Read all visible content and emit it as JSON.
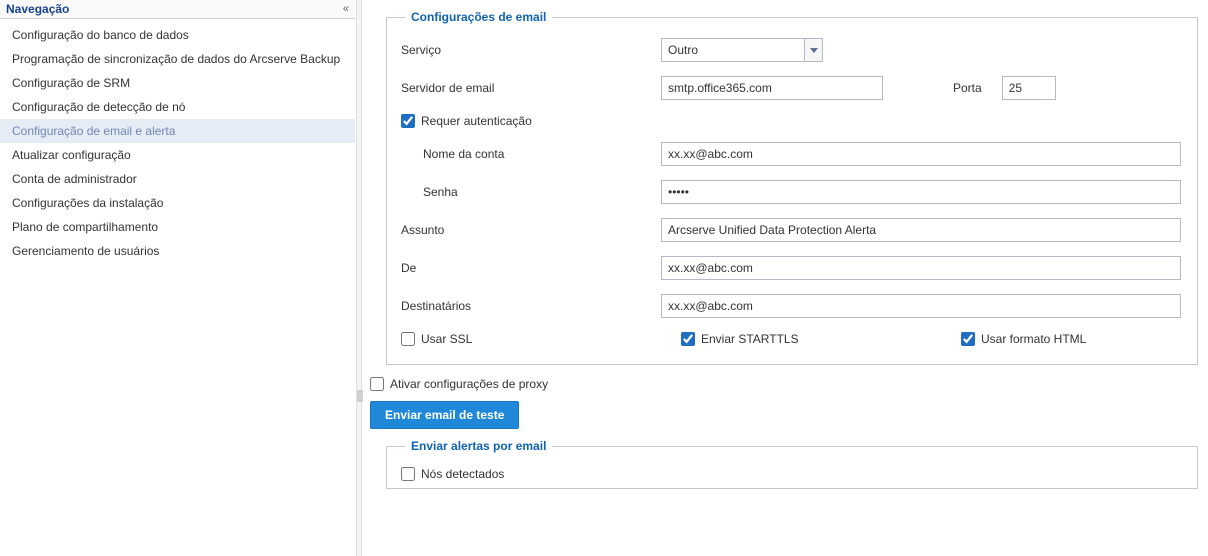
{
  "sidebar": {
    "title": "Navegação",
    "items": [
      {
        "label": "Configuração do banco de dados"
      },
      {
        "label": "Programação de sincronização de dados do Arcserve Backup"
      },
      {
        "label": "Configuração de SRM"
      },
      {
        "label": "Configuração de detecção de nó"
      },
      {
        "label": "Configuração de email e alerta"
      },
      {
        "label": "Atualizar configuração"
      },
      {
        "label": "Conta de administrador"
      },
      {
        "label": "Configurações da instalação"
      },
      {
        "label": "Plano de compartilhamento"
      },
      {
        "label": "Gerenciamento de usuários"
      }
    ],
    "selected_index": 4
  },
  "email_group": {
    "legend": "Configurações de email",
    "service_label": "Serviço",
    "service_value": "Outro",
    "server_label": "Servidor de email",
    "server_value": "smtp.office365.com",
    "port_label": "Porta",
    "port_value": "25",
    "requires_auth_label": "Requer autenticação",
    "account_label": "Nome da conta",
    "account_value": "xx.xx@abc.com",
    "password_label": "Senha",
    "password_value": "•••••",
    "subject_label": "Assunto",
    "subject_value": "Arcserve Unified Data Protection Alerta",
    "from_label": "De",
    "from_value": "xx.xx@abc.com",
    "recipients_label": "Destinatários",
    "recipients_value": "xx.xx@abc.com",
    "use_ssl_label": "Usar SSL",
    "send_starttls_label": "Enviar STARTTLS",
    "use_html_label": "Usar formato HTML"
  },
  "proxy_label": "Ativar configurações de proxy",
  "send_test_button": "Enviar email de teste",
  "alerts_group": {
    "legend": "Enviar alertas por email",
    "nodes_detected_label": "Nós detectados"
  }
}
